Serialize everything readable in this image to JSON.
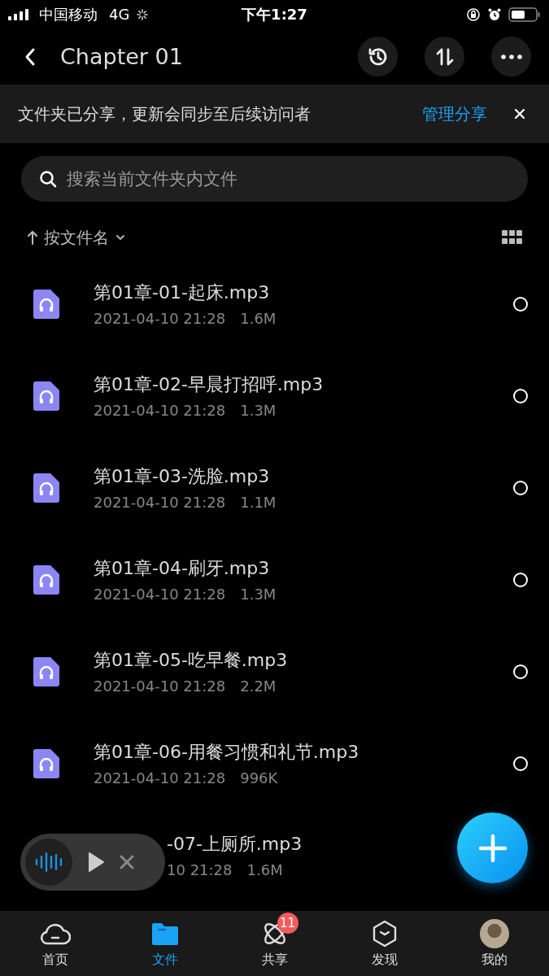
{
  "status_bar": {
    "carrier": "中国移动",
    "network": "4G",
    "time": "下午1:27"
  },
  "header": {
    "title": "Chapter 01"
  },
  "banner": {
    "message": "文件夹已分享，更新会同步至后续访问者",
    "action": "管理分享"
  },
  "search": {
    "placeholder": "搜索当前文件夹内文件"
  },
  "sort": {
    "label": "按文件名"
  },
  "files": [
    {
      "name": "第01章-01-起床.mp3",
      "date": "2021-04-10 21:28",
      "size": "1.6M",
      "selected": false
    },
    {
      "name": "第01章-02-早晨打招呼.mp3",
      "date": "2021-04-10 21:28",
      "size": "1.3M",
      "selected": false
    },
    {
      "name": "第01章-03-洗脸.mp3",
      "date": "2021-04-10 21:28",
      "size": "1.1M",
      "selected": false
    },
    {
      "name": "第01章-04-刷牙.mp3",
      "date": "2021-04-10 21:28",
      "size": "1.3M",
      "selected": false
    },
    {
      "name": "第01章-05-吃早餐.mp3",
      "date": "2021-04-10 21:28",
      "size": "2.2M",
      "selected": false
    },
    {
      "name": "第01章-06-用餐习惯和礼节.mp3",
      "date": "2021-04-10 21:28",
      "size": "996K",
      "selected": false
    },
    {
      "name": "-07-上厕所.mp3",
      "date": "10 21:28",
      "size": "1.6M",
      "covered": true
    }
  ],
  "tabs": [
    {
      "kind": "home",
      "label": "首页",
      "selected": false
    },
    {
      "kind": "files",
      "label": "文件",
      "selected": true
    },
    {
      "kind": "share",
      "label": "共享",
      "selected": false,
      "badge": "11"
    },
    {
      "kind": "discover",
      "label": "发现",
      "selected": false
    },
    {
      "kind": "me",
      "label": "我的",
      "selected": false
    }
  ]
}
